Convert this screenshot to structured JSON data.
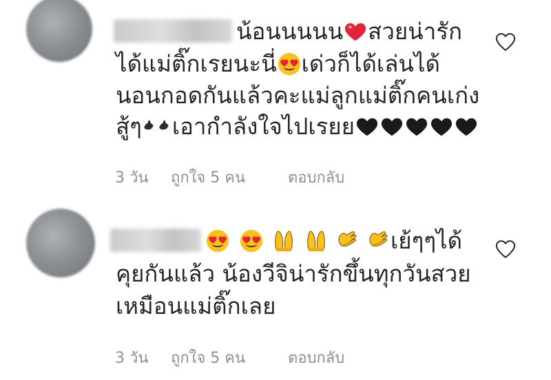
{
  "comments": [
    {
      "lines": [
        "น้อนนนนน",
        "สวยน่ารัก",
        "ได้แม่ติ๊กเรยนะนี่",
        "เด่วก็ได้เล่นได้",
        "นอนกอดกันแล้วคะแม่ลูกแม่ติ๊กคนเก่ง",
        "สู้ๆ",
        "เอากำลังใจไปเรยย"
      ],
      "meta": {
        "time": "3 วัน",
        "likes": "ถูกใจ 5 คน",
        "reply": "ตอบกลับ"
      }
    },
    {
      "lines": [
        "เย้ๆๆได้",
        "คุยกันแล้ว น้องวีจิน่ารักขึ้นทุกวันสวย",
        "เหมือนแม่ติ๊กเลย"
      ],
      "meta": {
        "time": "3 วัน",
        "likes": "ถูกใจ 5 คน",
        "reply": "ตอบกลับ"
      }
    }
  ],
  "icons": {
    "heart_emoji": "red-heart-icon",
    "heart_eyes": "heart-eyes-icon",
    "praying_hands": "praying-hands-icon",
    "clapping_hands": "clapping-hands-icon",
    "black_heart": "black-heart-icon",
    "like": "heart-outline-icon"
  },
  "colors": {
    "text": "#262626",
    "meta": "#8e8e8e",
    "heart_red": "#e0243a",
    "emoji_yellow": "#f7c21b"
  }
}
